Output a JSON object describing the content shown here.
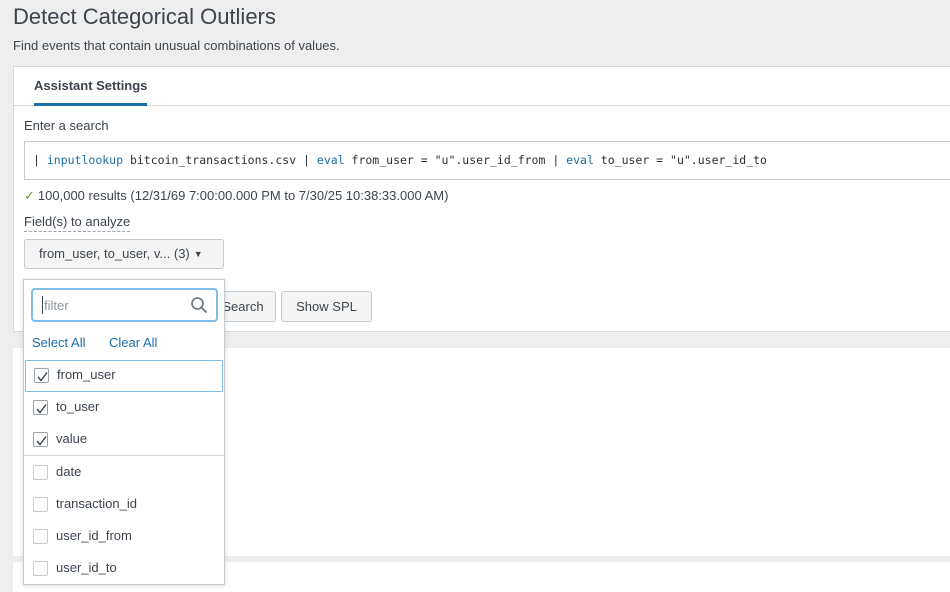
{
  "header": {
    "title": "Detect Categorical Outliers",
    "subtitle": "Find events that contain unusual combinations of values."
  },
  "tabs": [
    {
      "label": "Assistant Settings",
      "active": true
    }
  ],
  "search": {
    "label": "Enter a search",
    "segments": [
      {
        "text": "| ",
        "kw": false
      },
      {
        "text": "inputlookup",
        "kw": true
      },
      {
        "text": " bitcoin_transactions.csv | ",
        "kw": false
      },
      {
        "text": "eval",
        "kw": true
      },
      {
        "text": " from_user = \"u\".user_id_from | ",
        "kw": false
      },
      {
        "text": "eval",
        "kw": true
      },
      {
        "text": " to_user = \"u\".user_id_to",
        "kw": false
      }
    ]
  },
  "results": {
    "check_icon": "checkmark-icon",
    "text": "100,000 results (12/31/69 7:00:00.000 PM to 7/30/25 10:38:33.000 AM)"
  },
  "fields": {
    "label": "Field(s) to analyze",
    "selected_display": "from_user, to_user, v... (3)"
  },
  "buttons": {
    "search_label": "Search",
    "show_spl_label": "Show SPL"
  },
  "dropdown": {
    "filter_placeholder": "filter",
    "select_all": "Select All",
    "clear_all": "Clear All",
    "options": [
      {
        "label": "from_user",
        "checked": true
      },
      {
        "label": "to_user",
        "checked": true
      },
      {
        "label": "value",
        "checked": true
      },
      {
        "label": "date",
        "checked": false
      },
      {
        "label": "transaction_id",
        "checked": false
      },
      {
        "label": "user_id_from",
        "checked": false
      },
      {
        "label": "user_id_to",
        "checked": false
      }
    ]
  },
  "colors": {
    "accent": "#1a6fa8",
    "success": "#5ca032",
    "focus": "#7fbee8"
  }
}
